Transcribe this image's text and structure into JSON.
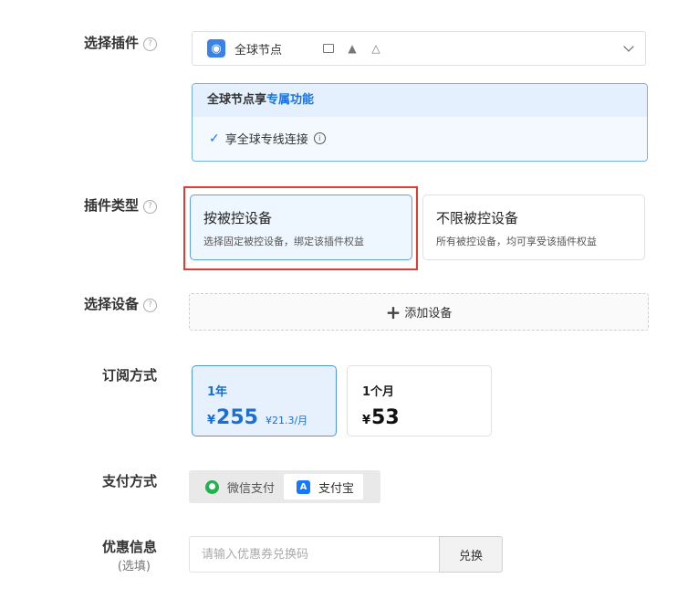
{
  "plugin": {
    "label": "选择插件",
    "help_icon": "?",
    "selected": "全球节点",
    "os_icons": [
      "windows-icon",
      "mac-icon",
      "android-icon",
      "linux-icon",
      "windows-icon"
    ]
  },
  "feature_panel": {
    "title_prefix": "全球节点享",
    "title_highlight": "专属功能",
    "items": [
      "享全球专线连接"
    ]
  },
  "plugin_type": {
    "label": "插件类型",
    "options": [
      {
        "title": "按被控设备",
        "desc": "选择固定被控设备，绑定该插件权益"
      },
      {
        "title": "不限被控设备",
        "desc": "所有被控设备，均可享受该插件权益"
      }
    ],
    "selected_index": 0
  },
  "device": {
    "label": "选择设备",
    "add_label": "添加设备"
  },
  "subscription": {
    "label": "订阅方式",
    "plans": [
      {
        "name": "1年",
        "currency": "¥",
        "price": "255",
        "per_month": "¥21.3/月"
      },
      {
        "name": "1个月",
        "currency": "¥",
        "price": "53",
        "per_month": ""
      }
    ],
    "selected_index": 0
  },
  "payment": {
    "label": "支付方式",
    "options": [
      "微信支付",
      "支付宝"
    ],
    "selected_index": 1
  },
  "coupon": {
    "label": "优惠信息",
    "sub_label": "(选填)",
    "placeholder": "请输入优惠券兑换码",
    "button": "兑换"
  },
  "colors": {
    "accent": "#1a73e8",
    "highlight_border": "#e53a2f"
  }
}
